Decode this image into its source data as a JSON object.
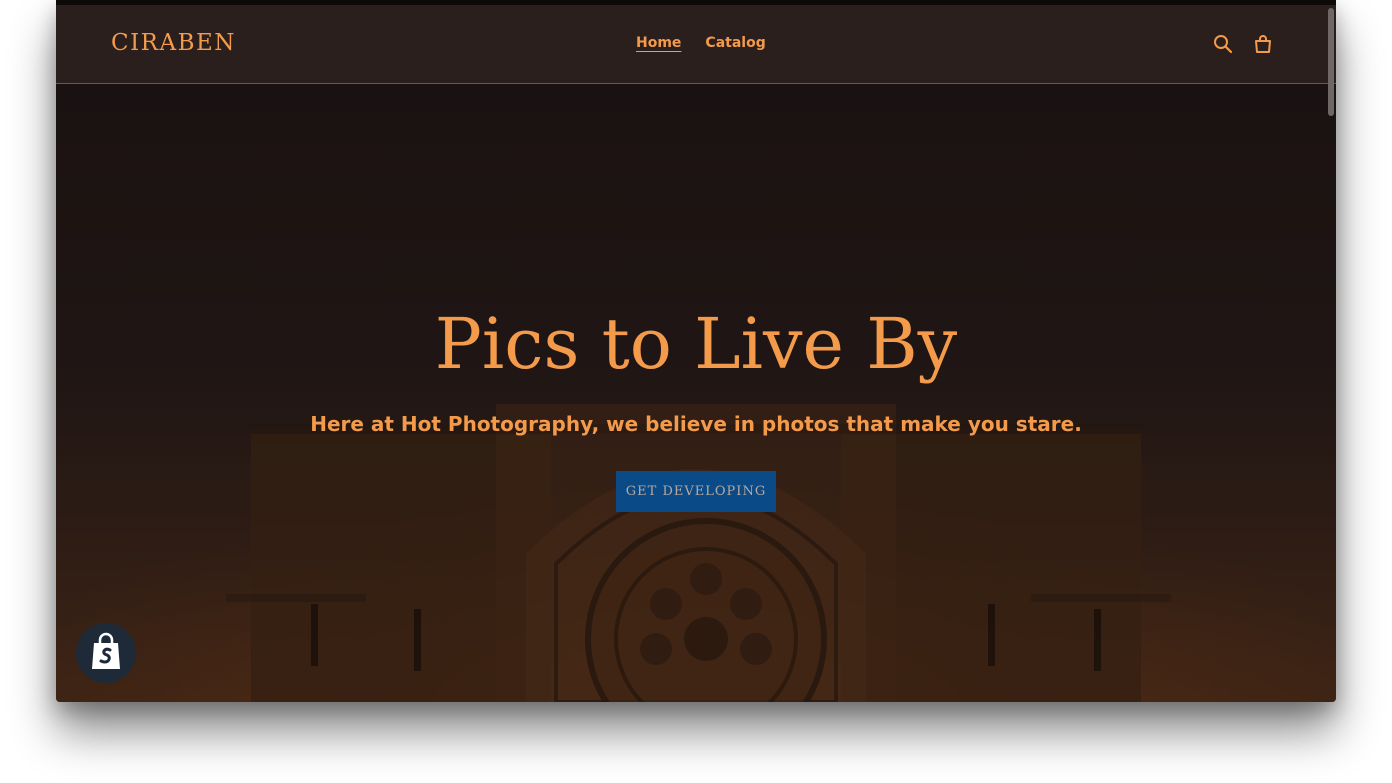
{
  "header": {
    "logo": "CIRABEN",
    "nav": [
      {
        "label": "Home",
        "active": true
      },
      {
        "label": "Catalog",
        "active": false
      }
    ],
    "icons": [
      "search-icon",
      "cart-icon"
    ]
  },
  "hero": {
    "title": "Pics to Live By",
    "subtitle": "Here at Hot Photography, we believe in photos that make you stare.",
    "button_label": "GET DEVELOPING"
  },
  "badge": {
    "icon": "shopify-bag-icon"
  },
  "colors": {
    "accent": "#f39b4a",
    "header_bg": "#2a1f1d",
    "button_bg": "#0a4a86",
    "badge_bg": "#1e2a38"
  }
}
